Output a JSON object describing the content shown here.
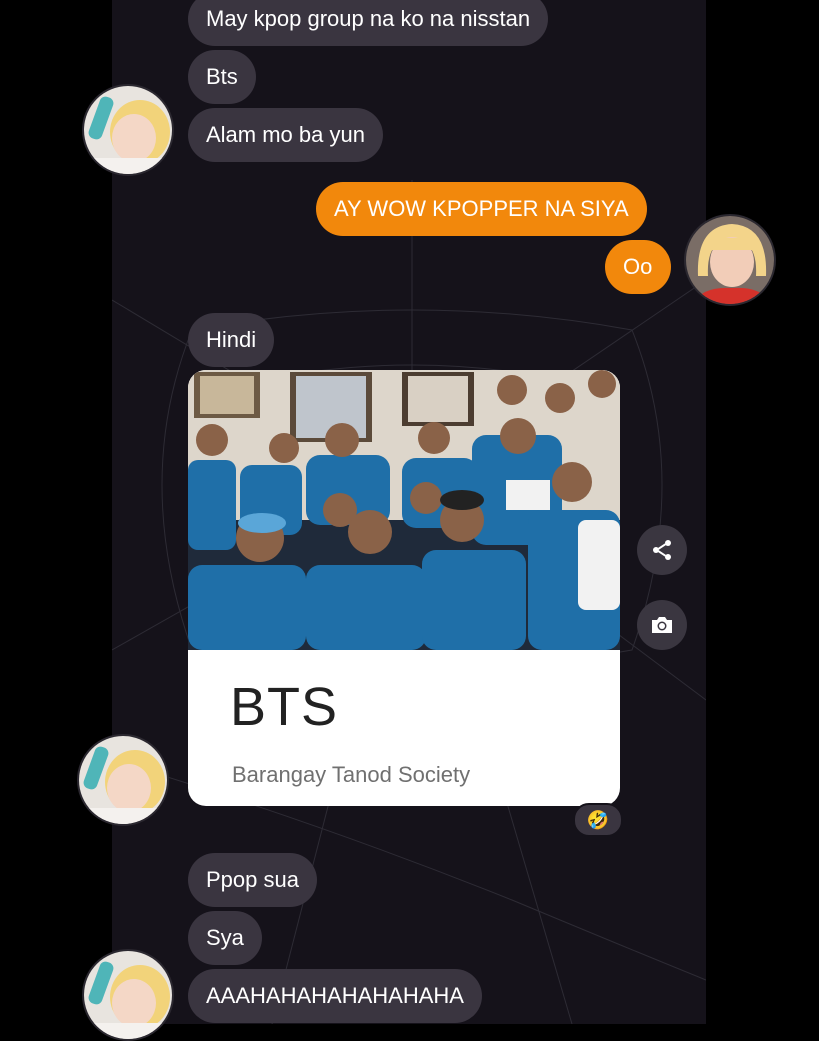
{
  "messages": [
    {
      "text": "May kpop group na ko na nisstan",
      "side": "incoming"
    },
    {
      "text": "Bts",
      "side": "incoming"
    },
    {
      "text": "Alam mo ba yun",
      "side": "incoming"
    },
    {
      "text": "AY WOW KPOPPER NA SIYA",
      "side": "outgoing"
    },
    {
      "text": "Oo",
      "side": "outgoing"
    },
    {
      "text": "Hindi",
      "side": "incoming"
    },
    {
      "text": "Ppop sua",
      "side": "incoming"
    },
    {
      "text": "Sya",
      "side": "incoming"
    },
    {
      "text": "AAAHAHAHAHAHAHAHA",
      "side": "incoming"
    }
  ],
  "card": {
    "title": "BTS",
    "subtitle": "Barangay Tanod Society"
  },
  "reaction": {
    "emoji": "🤣"
  },
  "icons": {
    "share": "share-icon",
    "camera": "camera-icon"
  },
  "colors": {
    "outgoing": "#f2880c",
    "incoming": "#3a3540",
    "background": "#15121a"
  }
}
